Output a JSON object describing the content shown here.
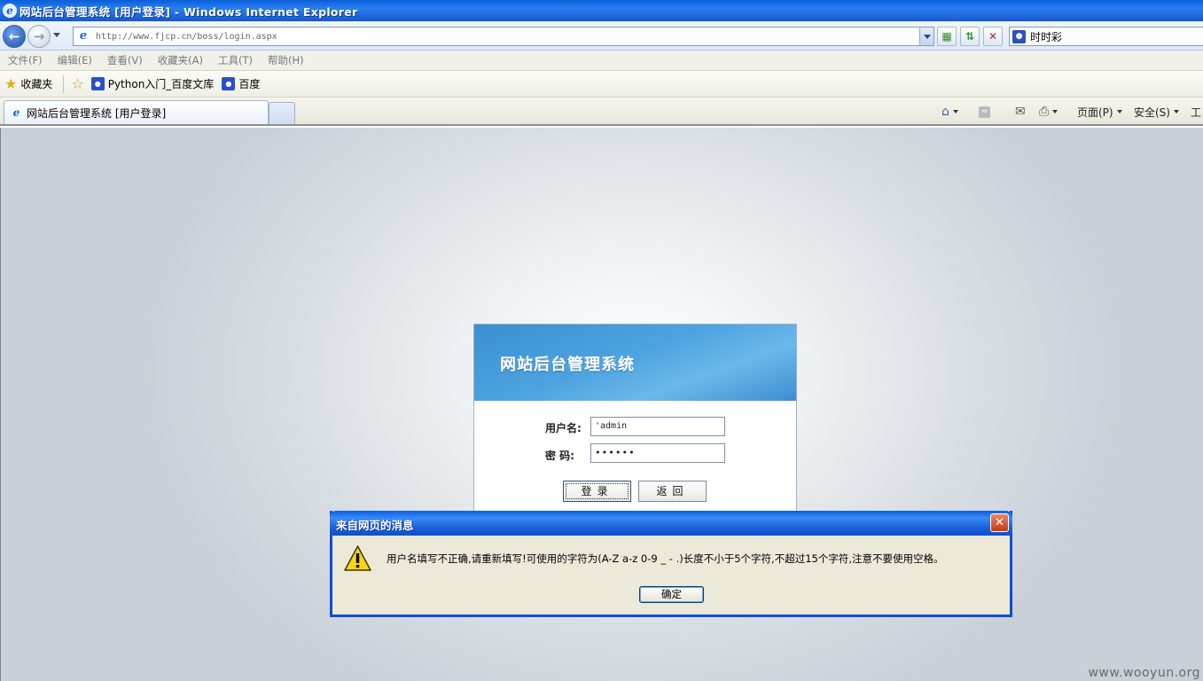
{
  "window": {
    "title": "网站后台管理系统 [用户登录] - Windows Internet Explorer"
  },
  "address": {
    "url": "http://www.fjcp.cn/boss/login.aspx"
  },
  "search": {
    "value": "时时彩"
  },
  "menu": {
    "items": [
      "文件(F)",
      "编辑(E)",
      "查看(V)",
      "收藏夹(A)",
      "工具(T)",
      "帮助(H)"
    ]
  },
  "favorites": {
    "label": "收藏夹",
    "links": [
      "Python入门_百度文库",
      "百度"
    ]
  },
  "tabs": {
    "active_label": "网站后台管理系统 [用户登录]"
  },
  "commands": {
    "page": "页面(P)",
    "safety": "安全(S)",
    "tools": "工"
  },
  "login": {
    "system_title": "网站后台管理系统",
    "username_label": "用户名:",
    "username_value": "'admin",
    "password_label": "密 码:",
    "password_value": "••••••",
    "login_button": "登录",
    "back_button": "返回"
  },
  "dialog": {
    "title": "来自网页的消息",
    "message": "用户名填写不正确,请重新填写!可使用的字符为(A-Z a-z 0-9 _ - .)长度不小于5个字符,不超过15个字符,注意不要使用空格。",
    "ok_button": "确定"
  },
  "watermark": "www.wooyun.org"
}
